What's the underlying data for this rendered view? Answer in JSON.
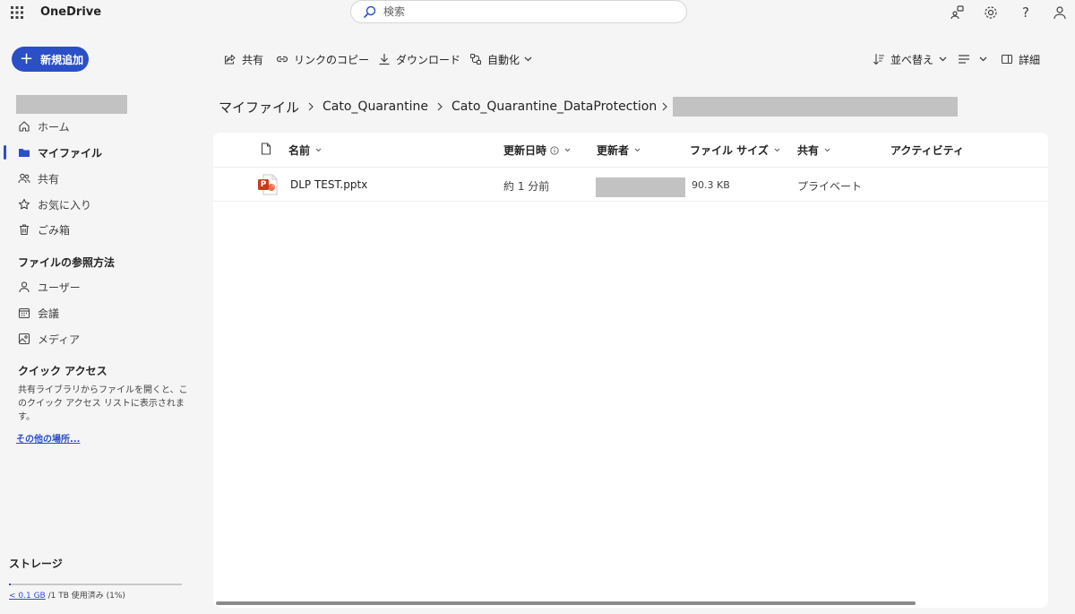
{
  "header": {
    "app_name": "OneDrive",
    "search_placeholder": "検索"
  },
  "new_button": {
    "label": "新規追加"
  },
  "sidebar": {
    "nav": [
      {
        "label": "ホーム",
        "icon": "home-icon"
      },
      {
        "label": "マイファイル",
        "icon": "folder-icon",
        "active": true
      },
      {
        "label": "共有",
        "icon": "people-icon"
      },
      {
        "label": "お気に入り",
        "icon": "star-icon"
      },
      {
        "label": "ごみ箱",
        "icon": "trash-icon"
      }
    ],
    "browse_heading": "ファイルの参照方法",
    "browse": [
      {
        "label": "ユーザー",
        "icon": "person-icon"
      },
      {
        "label": "会議",
        "icon": "calendar-icon"
      },
      {
        "label": "メディア",
        "icon": "image-icon"
      }
    ],
    "quick_access_heading": "クイック アクセス",
    "quick_access_desc": "共有ライブラリからファイルを開くと、このクイック アクセス リストに表示されます。",
    "more_places": "その他の場所..."
  },
  "storage": {
    "heading": "ストレージ",
    "used": "< 0.1 GB",
    "rest": " /1 TB 使用済み (1%)",
    "fraction": 0.01
  },
  "toolbar": {
    "share": "共有",
    "copy_link": "リンクのコピー",
    "download": "ダウンロード",
    "automate": "自動化",
    "sort": "並べ替え",
    "details": "詳細"
  },
  "breadcrumb": {
    "root": "マイファイル",
    "items": [
      "Cato_Quarantine",
      "Cato_Quarantine_DataProtection"
    ]
  },
  "columns": {
    "name": "名前",
    "modified": "更新日時",
    "modified_by": "更新者",
    "size": "ファイル サイズ",
    "sharing": "共有",
    "activity": "アクティビティ"
  },
  "files": [
    {
      "name": "DLP TEST.pptx",
      "modified": "約 1 分前",
      "size": "90.3 KB",
      "sharing": "プライベート",
      "icon": "powerpoint-file-icon",
      "icon_letter": "P"
    }
  ]
}
